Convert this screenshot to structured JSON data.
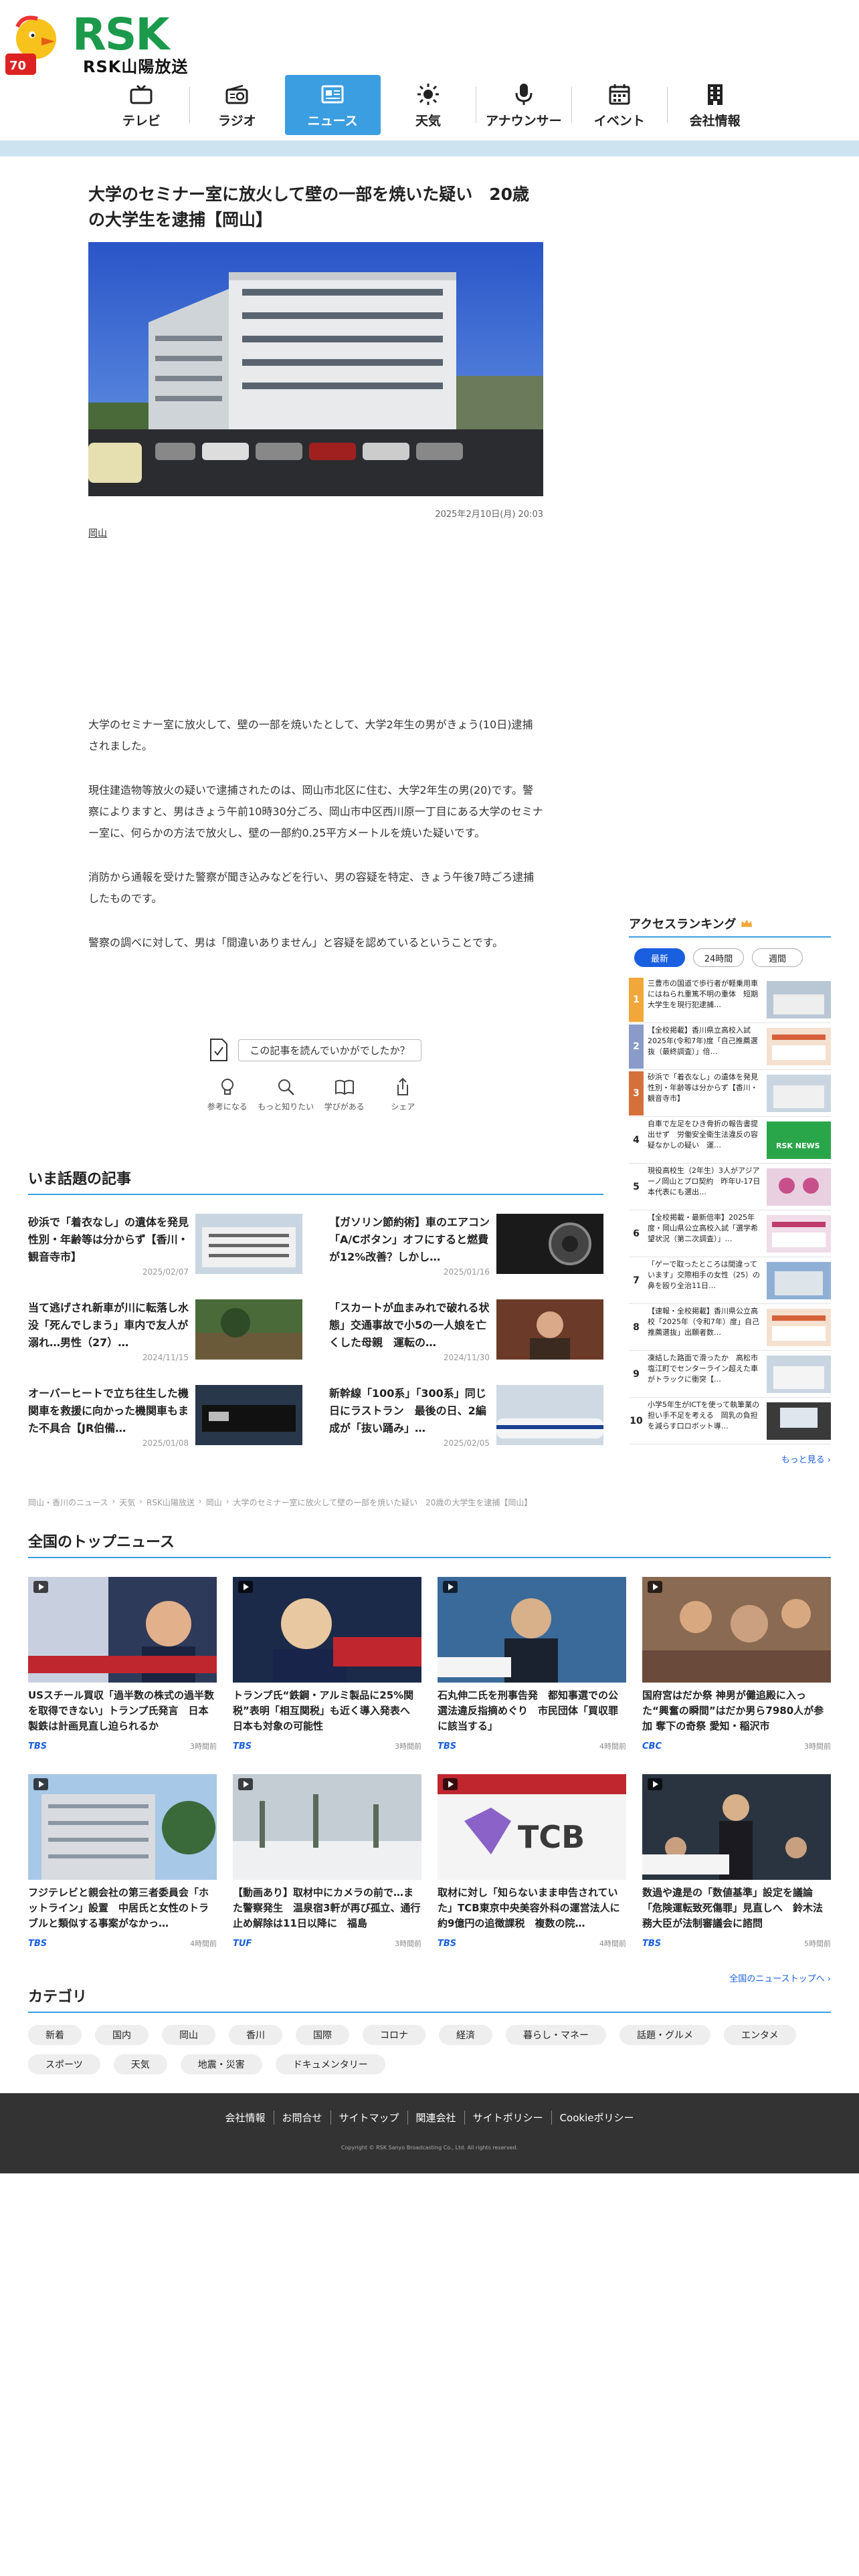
{
  "header": {
    "brand_mark": "RSK",
    "brand_name": "RSK山陽放送",
    "nav": [
      {
        "label": "テレビ",
        "icon": "tv-icon"
      },
      {
        "label": "ラジオ",
        "icon": "radio-icon"
      },
      {
        "label": "ニュース",
        "icon": "news-icon",
        "active": true
      },
      {
        "label": "天気",
        "icon": "sun-icon"
      },
      {
        "label": "アナウンサー",
        "icon": "microphone-icon"
      },
      {
        "label": "イベント",
        "icon": "calendar-icon"
      },
      {
        "label": "会社情報",
        "icon": "building-icon"
      }
    ]
  },
  "article": {
    "title": "大学のセミナー室に放火して壁の一部を焼いた疑い　20歳の大学生を逮捕【岡山】",
    "date": "2025年2月10日(月) 20:03",
    "tag": "岡山",
    "paragraphs": [
      "大学のセミナー室に放火して、壁の一部を焼いたとして、大学2年生の男がきょう(10日)逮捕されました。",
      "現住建造物等放火の疑いで逮捕されたのは、岡山市北区に住む、大学2年生の男(20)です。警察によりますと、男はきょう午前10時30分ごろ、岡山市中区西川原一丁目にある大学のセミナー室に、何らかの方法で放火し、壁の一部約0.25平方メートルを焼いた疑いです。",
      "消防から通報を受けた警察が聞き込みなどを行い、男の容疑を特定、きょう午後7時ごろ逮捕したものです。",
      "警察の調べに対して、男は「間違いありません」と容疑を認めているということです。"
    ]
  },
  "feedback": {
    "question": "この記事を読んでいかがでしたか？",
    "reactions": [
      {
        "label": "参考になる",
        "icon": "lightbulb-icon"
      },
      {
        "label": "もっと知りたい",
        "icon": "magnifier-icon"
      },
      {
        "label": "学びがある",
        "icon": "book-icon"
      },
      {
        "label": "シェア",
        "icon": "share-icon"
      }
    ]
  },
  "trending": {
    "title": "いま話題の記事",
    "items": [
      {
        "title": "砂浜で「着衣なし」の遺体を発見　性別・年齢等は分からず【香川・観音寺市】",
        "date": "2025/02/07"
      },
      {
        "title": "【ガソリン節約術】車のエアコン「A/Cボタン」オフにすると燃費が12%改善？しかし…",
        "date": "2025/01/16"
      },
      {
        "title": "当て逃げされ新車が川に転落し水没「死んでしまう」車内で友人が溺れ…男性（27）…",
        "date": "2024/11/15"
      },
      {
        "title": "「スカートが血まみれで破れる状態」交通事故で小5の一人娘を亡くした母親　運転の…",
        "date": "2024/11/30"
      },
      {
        "title": "オーバーヒートで立ち往生した機関車を救援に向かった機関車もまた不具合【JR伯備…",
        "date": "2025/01/08"
      },
      {
        "title": "新幹線「100系」「300系」同じ日にラストラン　最後の日、2編成が「抜い踊み」…",
        "date": "2025/02/05"
      }
    ]
  },
  "breadcrumb": [
    "岡山・香川のニュース",
    "天気",
    "RSK山陽放送",
    "岡山",
    "大学のセミナー室に放火して壁の一部を焼いた疑い　20歳の大学生を逮捕【岡山】"
  ],
  "ranking": {
    "title": "アクセスランキング",
    "tabs": [
      "最新",
      "24時間",
      "週間"
    ],
    "items": [
      {
        "rank": "1",
        "title": "三豊市の国道で歩行者が軽乗用車にはねられ重篤不明の重体　短期大学生を現行犯逮捕…"
      },
      {
        "rank": "2",
        "title": "【全校掲載】香川県立高校入試2025年(令和7年)度「自己推薦選抜（最終調査）」倍…"
      },
      {
        "rank": "3",
        "title": "砂浜で「着衣なし」の遺体を発見　性別・年齢等は分からず【香川・観音寺市】"
      },
      {
        "rank": "4",
        "title": "自車で左足をひき骨折の報告書提出せず　労働安全衛生法違反の容疑なかしの疑い　運…"
      },
      {
        "rank": "5",
        "title": "現役高校生（2年生）3人がアジアーノ岡山とプロ契約　昨年U-17日本代表にも選出…"
      },
      {
        "rank": "6",
        "title": "【全校掲載・最新倍率】2025年度・岡山県公立高校入試「選学希望状況（第二次調査）」…"
      },
      {
        "rank": "7",
        "title": "「ゲーで取ったところは間違っています」交際相手の女性（25）の鼻を殴り全治11日…"
      },
      {
        "rank": "8",
        "title": "【速報・全校掲載】香川県公立高校「2025年（令和7年）度」自己推薦選抜」出願者数…"
      },
      {
        "rank": "9",
        "title": "凍結した路面で滑ったか　高松市塩江町でセンターライン超えた車がトラックに衝突【…"
      },
      {
        "rank": "10",
        "title": "小学5年生がICTを使って執筆業の担い手不足を考える　岡乳の負担を減らす口ロボット導…"
      }
    ],
    "more": "もっと見る"
  },
  "national": {
    "title": "全国のトップニュース",
    "items": [
      {
        "title": "USスチール買収「過半数の株式の過半数を取得できない」トランプ氏発言　日本製鉄は計画見直し迫られるか",
        "source": "TBS",
        "time": "3時間前"
      },
      {
        "title": "トランプ氏“鉄鋼・アルミ製品に25%関税”表明「相互関税」も近く導入発表へ　日本も対象の可能性",
        "source": "TBS",
        "time": "3時間前"
      },
      {
        "title": "石丸伸二氏を刑事告発　都知事選での公選法違反指摘めぐり　市民団体「買収罪に該当する」",
        "source": "TBS",
        "time": "4時間前"
      },
      {
        "title": "国府宮はだか祭 神男が儺追殿に入った“興奮の瞬間”はだか男ら7980人が参加 奪下の奇祭 愛知・稲沢市",
        "source": "CBC",
        "time": "3時間前"
      },
      {
        "title": "フジテレビと親会社の第三者委員会「ホットライン」設置　中居氏と女性のトラブルと類似する事案がなかっ…",
        "source": "TBS",
        "time": "4時間前"
      },
      {
        "title": "【動画あり】取材中にカメラの前で…また警察発生　温泉宿3軒が再び孤立、通行止め解除は11日以降に　福島",
        "source": "TUF",
        "time": "3時間前"
      },
      {
        "title": "取材に対し「知らないまま申告されていた」TCB東京中央美容外科の運営法人に約9億円の追徴課税　複数の院…",
        "source": "TBS",
        "time": "4時間前"
      },
      {
        "title": "数過や違是の「数値基準」設定を議論「危険運転致死傷罪」見直しへ　鈴木法務大臣が法制審議会に諮問",
        "source": "TBS",
        "time": "5時間前"
      }
    ],
    "more": "全国のニューストップへ"
  },
  "category": {
    "title": "カテゴリ",
    "chips": [
      "新着",
      "国内",
      "岡山",
      "香川",
      "国際",
      "コロナ",
      "経済",
      "暮らし・マネー",
      "話題・グルメ",
      "エンタメ",
      "スポーツ",
      "天気",
      "地震・災害",
      "ドキュメンタリー"
    ]
  },
  "footer": {
    "links": [
      "会社情報",
      "お問合せ",
      "サイトマップ",
      "関連会社",
      "サイトポリシー",
      "Cookieポリシー"
    ],
    "copyright": "Copyright © RSK Sanyo Broadcasting Co., Ltd. All rights reserved."
  },
  "colors": {
    "accent": "#3b9ee0",
    "brand_green": "#1a9a4a",
    "link_blue": "#1a5fe0",
    "footer": "#333333"
  }
}
